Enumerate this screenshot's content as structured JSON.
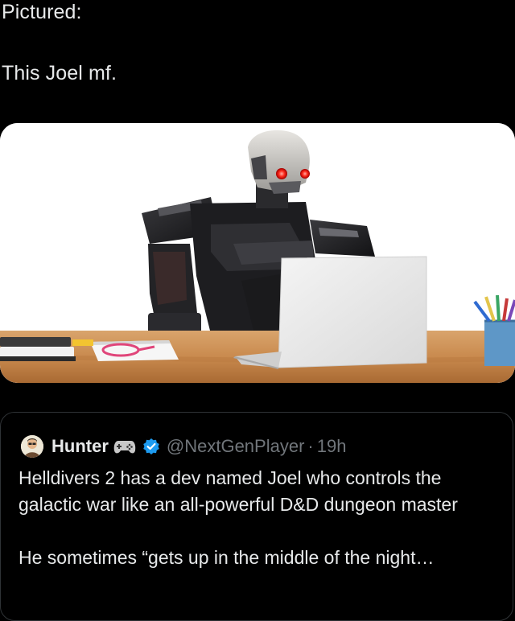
{
  "post": {
    "caption_line_1": "Pictured:",
    "caption_line_2": "This Joel mf."
  },
  "quoted_tweet": {
    "display_name": "Hunter",
    "badge_icon": "gamepad-icon",
    "verified_icon": "verified-icon",
    "handle": "@NextGenPlayer",
    "separator": "·",
    "time": "19h",
    "text_paragraph_1": "Helldivers 2 has a dev named Joel who controls the galactic war like an all-powerful D&D dungeon master",
    "text_paragraph_2": "He sometimes “gets up in the middle of the night…"
  },
  "colors": {
    "background": "#000000",
    "text_primary": "#e7e9ea",
    "text_secondary": "#71767b",
    "card_border": "#2f3336",
    "verified_blue": "#1d9bf0"
  }
}
